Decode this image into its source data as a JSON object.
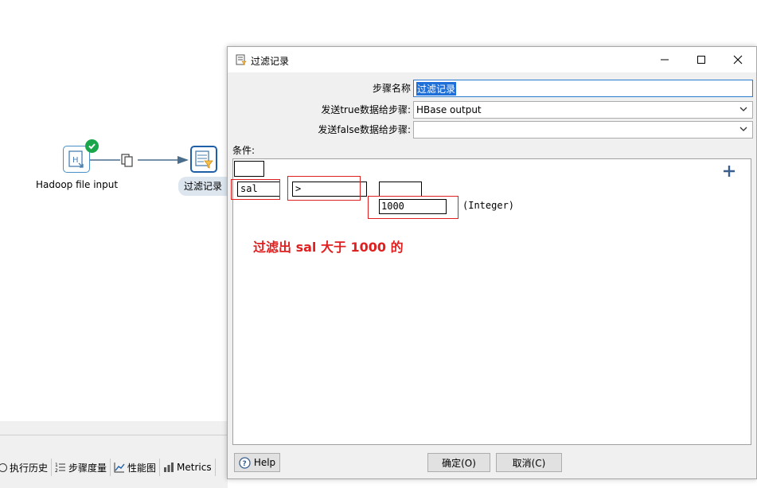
{
  "canvas": {
    "step1_label": "Hadoop file input",
    "step2_label": "过滤记录",
    "bottom_tabs": [
      {
        "label": "执行历史",
        "icon": "history-icon"
      },
      {
        "label": "步骤度量",
        "icon": "step-metrics-icon"
      },
      {
        "label": "性能图",
        "icon": "performance-chart-icon"
      },
      {
        "label": "Metrics",
        "icon": "metrics-icon"
      }
    ]
  },
  "dialog": {
    "title": "过滤记录",
    "step_name_label": "步骤名称",
    "step_name_value": "过滤记录",
    "true_label": "发送true数据给步骤:",
    "true_value": "HBase output",
    "false_label": "发送false数据给步骤:",
    "false_value": "",
    "condition_label": "条件:",
    "condition": {
      "field": "sal",
      "operator": ">",
      "value": "1000",
      "value_type": "(Integer)"
    },
    "annotation": "过滤出 sal 大于 1000 的",
    "help_label": "Help",
    "ok_label": "确定(O)",
    "cancel_label": "取消(C)"
  },
  "colors": {
    "accent_blue": "#1e5fa8",
    "annotation_red": "#e02020",
    "success_green": "#1aa64a"
  }
}
